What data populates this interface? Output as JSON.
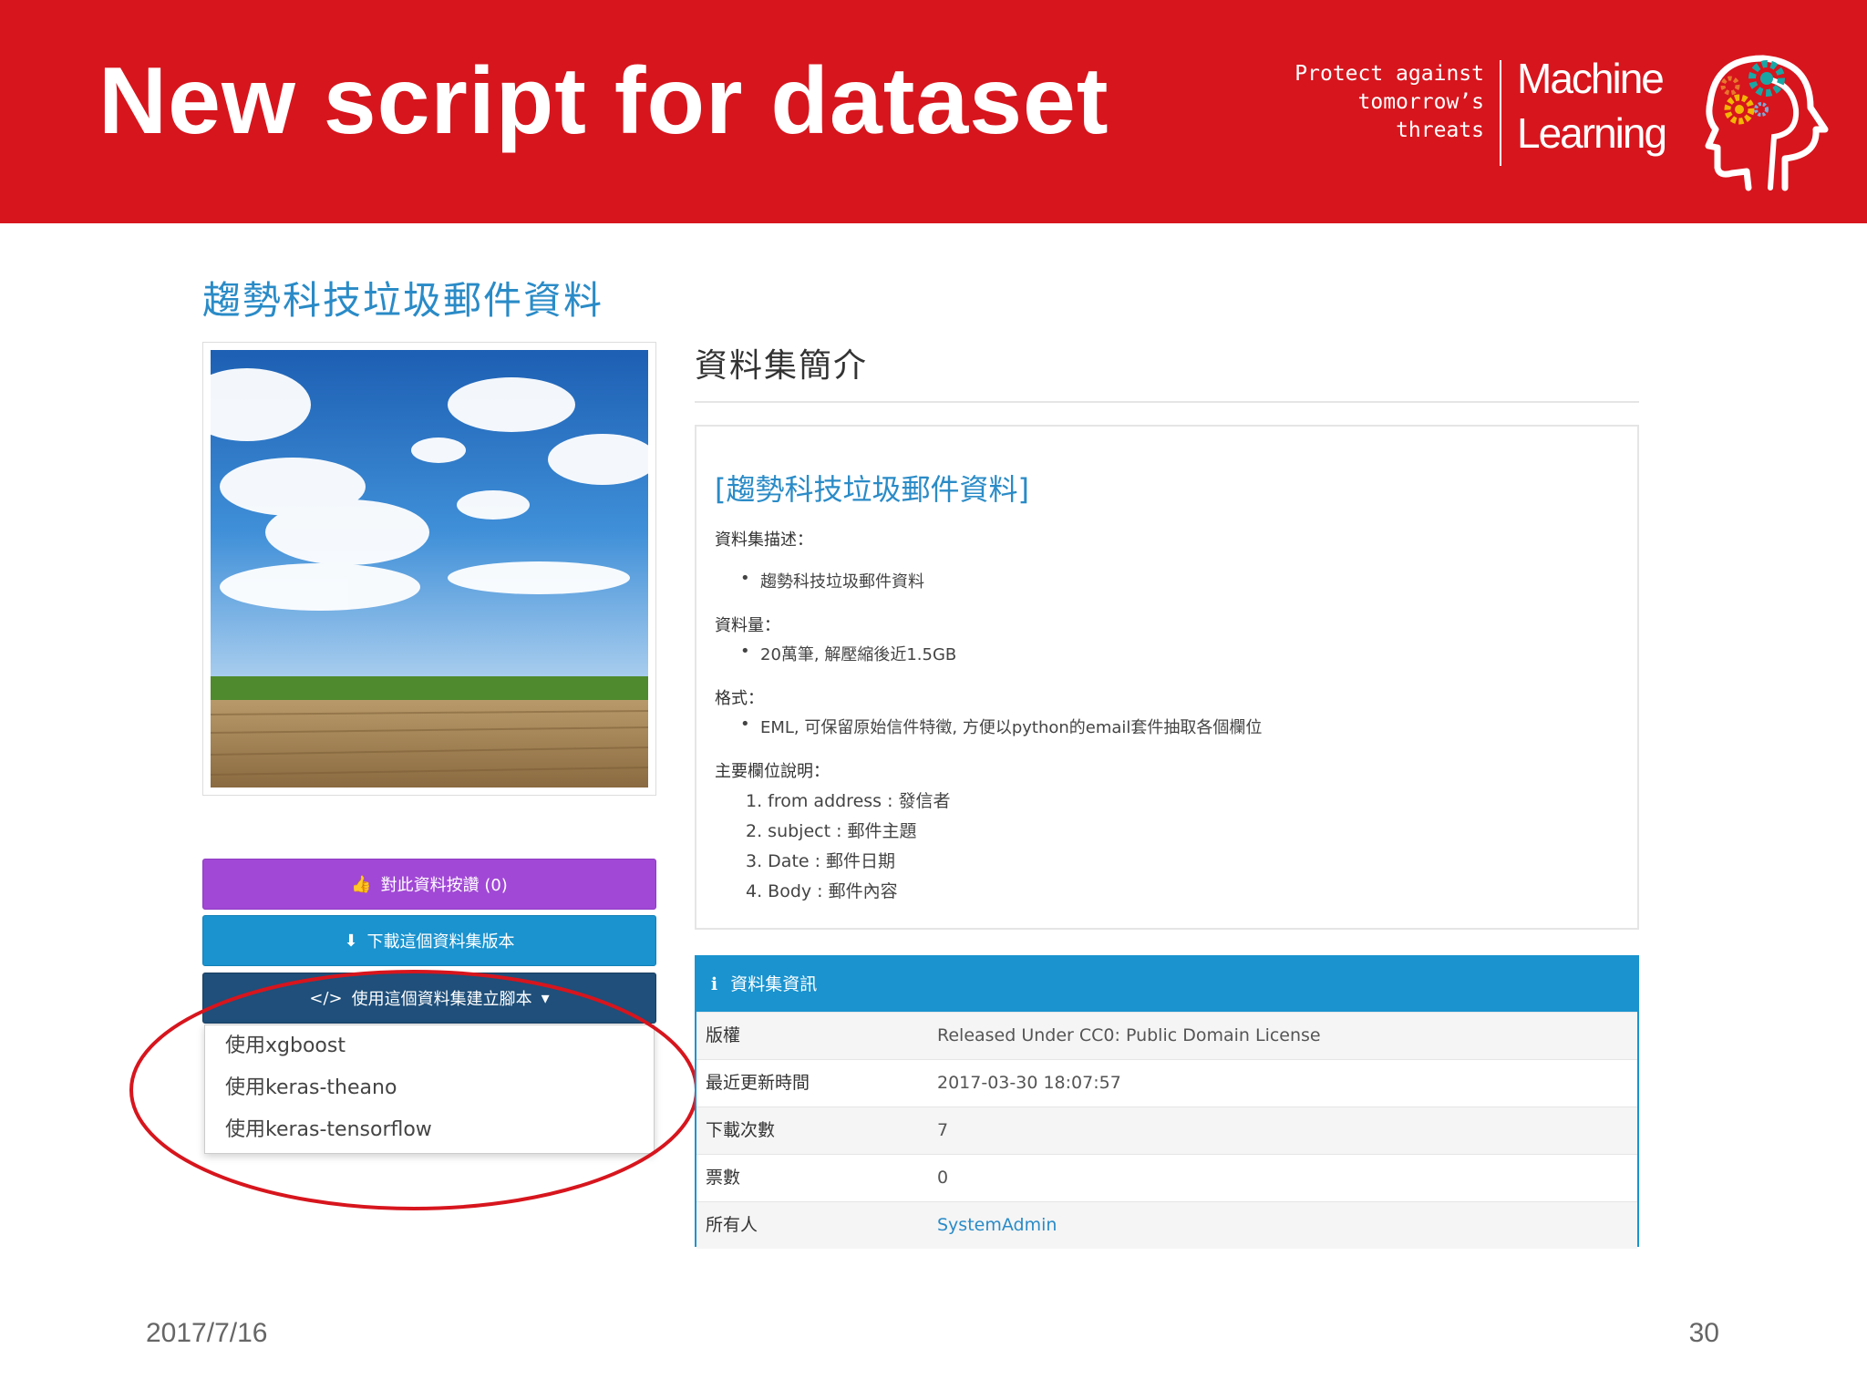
{
  "slide": {
    "title": "New script for dataset",
    "tagline": [
      "Protect against",
      "tomorrow’s",
      "threats"
    ],
    "brand": [
      "Machine",
      "Learning"
    ],
    "date": "2017/7/16",
    "page_number": "30",
    "accent_color": "#d7151d"
  },
  "dataset": {
    "title": "趨勢科技垃圾郵件資料",
    "buttons": {
      "like": "對此資料按讚 (0)",
      "download": "下載這個資料集版本",
      "create_script": "使用這個資料集建立腳本"
    },
    "dropdown": [
      "使用xgboost",
      "使用keras-theano",
      "使用keras-tensorflow"
    ],
    "intro_heading": "資料集簡介",
    "description": {
      "title": "[趨勢科技垃圾郵件資料]",
      "desc_label": "資料集描述：",
      "desc_item": "趨勢科技垃圾郵件資料",
      "volume_label": "資料量：",
      "volume_item": "20萬筆, 解壓縮後近1.5GB",
      "format_label": "格式：",
      "format_item": "EML, 可保留原始信件特徵, 方便以python的email套件抽取各個欄位",
      "fields_label": "主要欄位說明：",
      "fields": [
        "1. from address : 發信者",
        "2. subject : 郵件主題",
        "3. Date : 郵件日期",
        "4. Body : 郵件內容"
      ]
    },
    "info": {
      "heading": "資料集資訊",
      "rows": [
        {
          "key": "版權",
          "value": "Released Under CC0: Public Domain License"
        },
        {
          "key": "最近更新時間",
          "value": "2017-03-30 18:07:57"
        },
        {
          "key": "下載次數",
          "value": "7"
        },
        {
          "key": "票數",
          "value": "0"
        },
        {
          "key": "所有人",
          "value": "SystemAdmin"
        }
      ]
    },
    "colors": {
      "link": "#2a8bc7",
      "like_button": "#a148d6",
      "download_button": "#1a93cf",
      "script_button": "#1f4f7a"
    }
  }
}
